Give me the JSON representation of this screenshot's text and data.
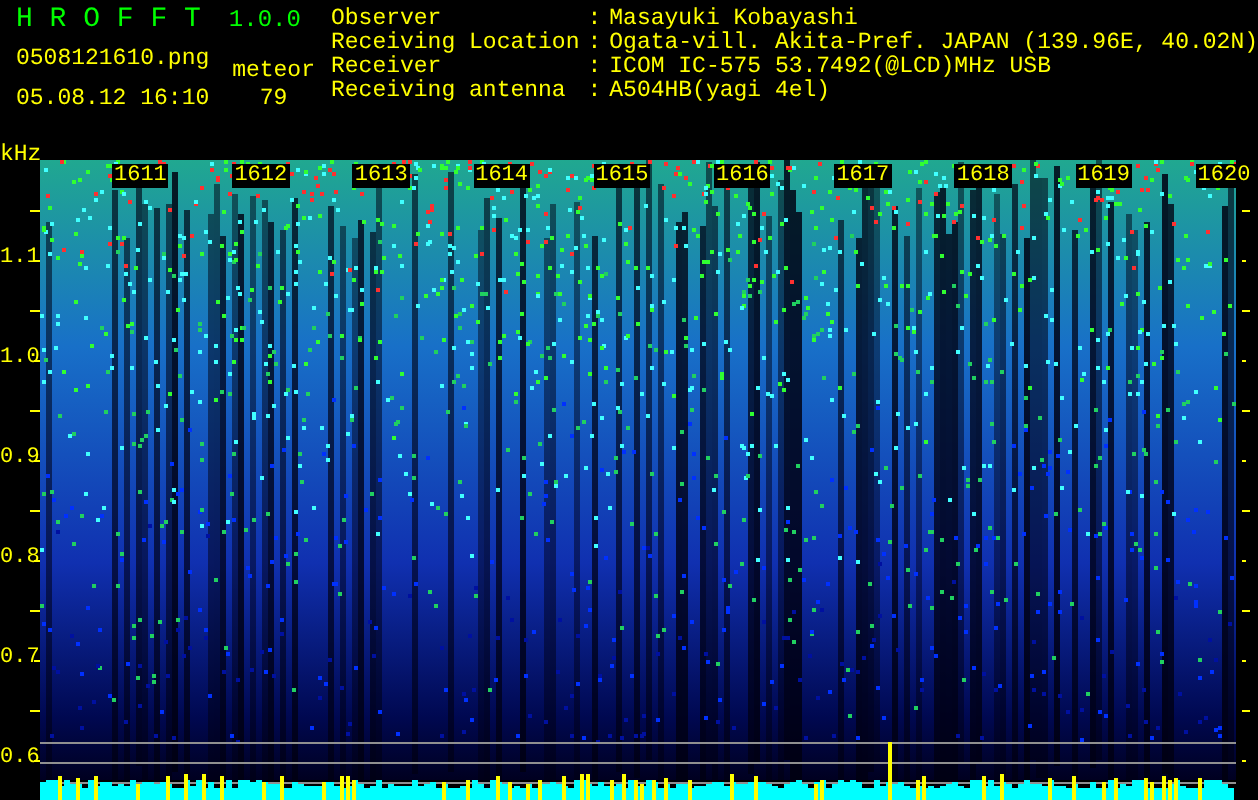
{
  "app": {
    "name": "H R O F F T",
    "version": "1.0.0"
  },
  "file": {
    "name": "0508121610.png",
    "datetime": "05.08.12 16:10"
  },
  "meteor": {
    "label": "meteor",
    "count": "79"
  },
  "info": [
    {
      "label": "Observer",
      "separator": ":",
      "value": "Masayuki Kobayashi"
    },
    {
      "label": "Receiving Location",
      "separator": ":",
      "value": "Ogata-vill. Akita-Pref. JAPAN (139.96E, 40.02N)"
    },
    {
      "label": "Receiver",
      "separator": ":",
      "value": "ICOM IC-575 53.7492(@LCD)MHz USB"
    },
    {
      "label": "Receiving antenna",
      "separator": ":",
      "value": "A504HB(yagi 4el)"
    }
  ],
  "spectrogram": {
    "unit": "kHz",
    "y_labels": [
      "1.1",
      "1.0",
      "0.9",
      "0.8",
      "0.7",
      "0.6"
    ],
    "time_labels": [
      "1611",
      "1612",
      "1613",
      "1614",
      "1615",
      "1616",
      "1617",
      "1618",
      "1619",
      "1620"
    ]
  }
}
